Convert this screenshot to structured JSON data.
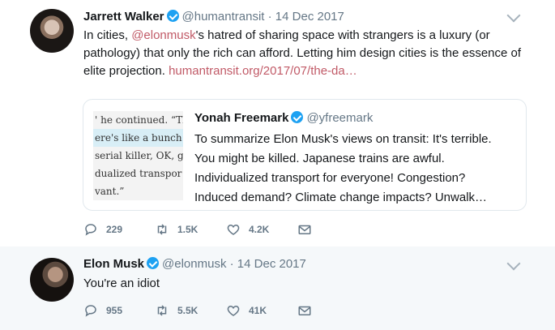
{
  "tweets": [
    {
      "author": "Jarrett Walker",
      "handle": "@humantransit",
      "date": "14 Dec 2017",
      "text_before_mention": "In cities, ",
      "mention": "@elonmusk",
      "text_after_mention": "'s hatred of sharing space with strangers is a luxury (or pathology) that only the rich can afford.  Letting him design cities is the essence of elite projection.",
      "link": "humantransit.org/2017/07/the-da…",
      "quoted": {
        "author": "Yonah Freemark",
        "handle": "@yfreemark",
        "text": "To summarize Elon Musk's views on transit: It's terrible. You might be killed. Japanese trains are awful. Individualized transport for everyone! Congestion? Induced demand? Climate change impacts? Unwalk…",
        "image_lines": [
          "' he continued. “Th",
          "ere's like a bunch c",
          "serial killer, OK, g",
          "dualized transpor",
          "vant.”"
        ]
      },
      "replies": "229",
      "retweets": "1.5K",
      "likes": "4.2K"
    },
    {
      "author": "Elon Musk",
      "handle": "@elonmusk",
      "date": "14 Dec 2017",
      "text": "You're an idiot",
      "replies": "955",
      "retweets": "5.5K",
      "likes": "41K"
    }
  ],
  "separator": "·",
  "colors": {
    "accent": "#c15a67",
    "verified": "#1da1f2",
    "thread": "#d7aeb1",
    "muted": "#657786"
  }
}
